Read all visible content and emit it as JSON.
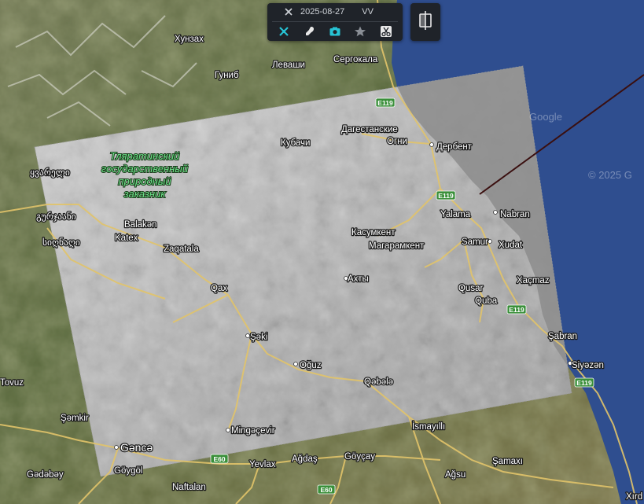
{
  "toolbar": {
    "date": "2025-08-27",
    "polarization": "VV",
    "colors": {
      "accent": "#27c3d4",
      "inactive": "#8a8f96",
      "background": "#1f2329"
    },
    "icons": [
      "crosshair-icon",
      "brush-icon",
      "camera-icon",
      "star-icon",
      "scissors-icon"
    ]
  },
  "compare_button": {
    "icon": "split-compare-icon"
  },
  "watermarks": {
    "google": "Google",
    "copyright": "© 2025 G"
  },
  "reserve_label": [
    "Тляратинский",
    "государственный",
    "природный",
    "заказник"
  ],
  "places": {
    "hunzakh": "Хунзах",
    "levashi": "Леваши",
    "sergokala": "Сергокала",
    "gunib": "Гуниб",
    "kubachi": "Кубачи",
    "dag_ogni_1": "Дагестанские",
    "dag_ogni_2": "Огни",
    "derbent": "Дербент",
    "kasumkent": "Касумкент",
    "magaramkent": "Магарамкент",
    "akhty": "Ахты",
    "yalama": "Yalama",
    "nabran": "Nabran",
    "samur": "Samur",
    "xudat": "Xudat",
    "qusar": "Qusar",
    "xacmaz": "Xaçmaz",
    "quba": "Quba",
    "sabran": "Şabran",
    "siyazan": "Siyəzən",
    "balaken": "Balakən",
    "katex": "Katex",
    "zaqatala": "Zaqatala",
    "qax": "Qax",
    "seki": "Şəki",
    "oguz": "Oğuz",
    "qabala": "Qəbələ",
    "ismayilli": "İsmayıllı",
    "mingecevir": "Mingəçevir",
    "ganca": "Gəncə",
    "goygol": "Göygöl",
    "gadabay": "Gədəbəy",
    "samkir": "Şəmkir",
    "tovuz": "Tovuz",
    "yevlax": "Yevlax",
    "agdas": "Ağdaş",
    "goycay": "Göyçay",
    "samaxi": "Şamaxı",
    "agsu": "Ağsu",
    "naftalan": "Naftalan",
    "xirdalan": "Xırd",
    "georgia_1": "ყვარელი",
    "georgia_2": "გურჯაანი",
    "georgia_3": "სიღნაღი"
  },
  "roads": {
    "e119": "E119",
    "e60": "E60"
  },
  "colors": {
    "sea": "#2e4c8e",
    "road": "#e2c46a",
    "shield": "#3a8f3a",
    "overlay_line": "#3a0f0f"
  }
}
